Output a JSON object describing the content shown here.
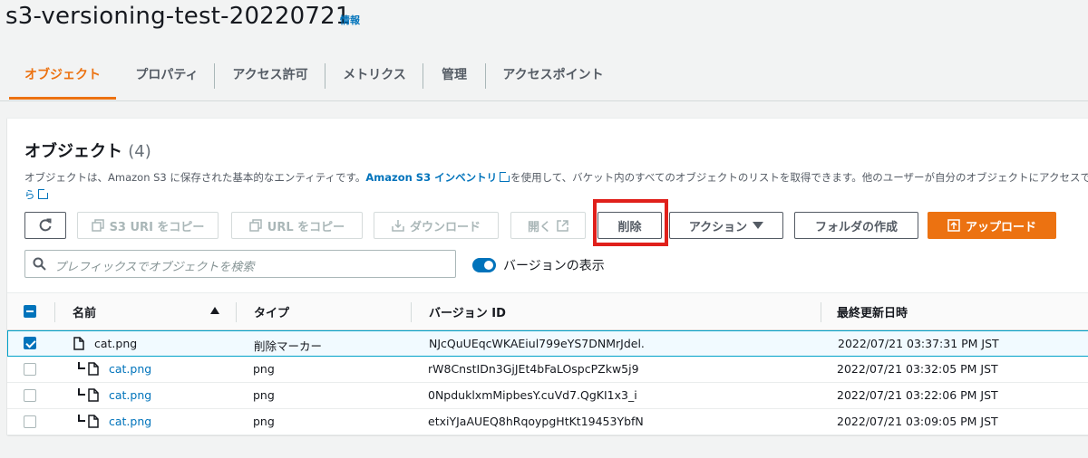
{
  "header": {
    "bucket_name": "s3-versioning-test-20220721",
    "info": "情報"
  },
  "tabs": [
    "オブジェクト",
    "プロパティ",
    "アクセス許可",
    "メトリクス",
    "管理",
    "アクセスポイント"
  ],
  "panel": {
    "title": "オブジェクト",
    "count": "(4)",
    "desc_before": "オブジェクトは、Amazon S3 に保存された基本的なエンティティです。",
    "desc_link": "Amazon S3 インベントリ",
    "desc_after": "を使用して、バケット内のすべてのオブジェクトのリストを取得できます。他のユーザーが自分のオブジェクトにアクセスで",
    "desc_cont": "ら"
  },
  "toolbar": {
    "copy_s3_uri": "S3 URI をコピー",
    "copy_url": "URL をコピー",
    "download": "ダウンロード",
    "open": "開く",
    "delete": "削除",
    "actions": "アクション",
    "create_folder": "フォルダの作成",
    "upload": "アップロード"
  },
  "search": {
    "placeholder": "プレフィックスでオブジェクトを検索"
  },
  "versions_toggle": {
    "label": "バージョンの表示",
    "on": true
  },
  "table": {
    "columns": [
      "名前",
      "タイプ",
      "バージョン ID",
      "最終更新日時"
    ],
    "rows": [
      {
        "name": "cat.png",
        "type": "削除マーカー",
        "version_id": "NJcQuUEqcWKAEiul799eYS7DNMrJdel.",
        "modified": "2022/07/21 03:37:31 PM JST",
        "checked": true,
        "child": false
      },
      {
        "name": "cat.png",
        "type": "png",
        "version_id": "rW8CnstIDn3GjJEt4bFaLOspcPZkw5j9",
        "modified": "2022/07/21 03:32:05 PM JST",
        "checked": false,
        "child": true
      },
      {
        "name": "cat.png",
        "type": "png",
        "version_id": "0NpduklxmMipbesY.cuVd7.QgKI1x3_i",
        "modified": "2022/07/21 03:22:06 PM JST",
        "checked": false,
        "child": true
      },
      {
        "name": "cat.png",
        "type": "png",
        "version_id": "etxiYJaAUEQ8hRqoypgHtKt19453YbfN",
        "modified": "2022/07/21 03:09:05 PM JST",
        "checked": false,
        "child": true
      }
    ]
  },
  "colors": {
    "accent": "#ec7211",
    "link": "#0073bb",
    "highlight": "#e0201b"
  }
}
